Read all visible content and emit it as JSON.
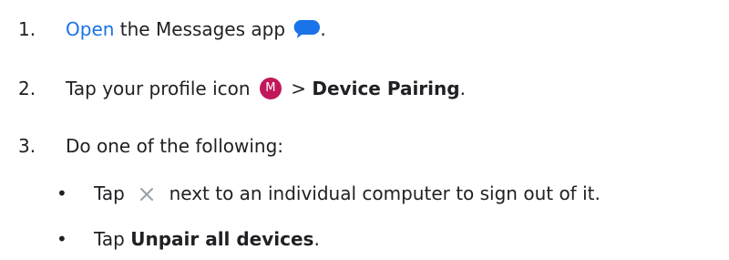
{
  "steps": [
    {
      "number": "1.",
      "link_text": "Open",
      "text_after_link": " the Messages app",
      "icon": "messages-app-icon",
      "trailing": "."
    },
    {
      "number": "2.",
      "text_before_icon": "Tap your profile icon",
      "avatar_letter": "M",
      "text_after_icon": " > ",
      "bold_text": "Device Pairing",
      "trailing": "."
    },
    {
      "number": "3.",
      "text": "Do one of the following:",
      "bullets": [
        {
          "marker": "•",
          "text_before_icon": "Tap",
          "icon": "close-x-icon",
          "text_after_icon": "next to an individual computer to sign out of it."
        },
        {
          "marker": "•",
          "text_before_bold": "Tap ",
          "bold_text": "Unpair all devices",
          "trailing": "."
        }
      ]
    }
  ],
  "colors": {
    "text": "#202124",
    "link": "#1a73e8",
    "messages_icon": "#1a73e8",
    "avatar_bg": "#c2185b"
  }
}
